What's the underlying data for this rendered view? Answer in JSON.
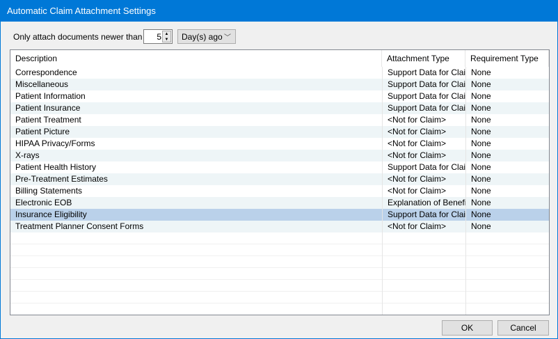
{
  "window": {
    "title": "Automatic Claim Attachment Settings"
  },
  "filter": {
    "label": "Only attach documents newer than :",
    "value": "5",
    "unit": "Day(s) ago"
  },
  "table": {
    "columns": [
      "Description",
      "Attachment Type",
      "Requirement Type"
    ],
    "rows": [
      [
        "Correspondence",
        "Support Data for Claim",
        "None"
      ],
      [
        "Miscellaneous",
        "Support Data for Claim",
        "None"
      ],
      [
        "Patient Information",
        "Support Data for Claim",
        "None"
      ],
      [
        "Patient Insurance",
        "Support Data for Claim",
        "None"
      ],
      [
        "Patient Treatment",
        "<Not for Claim>",
        "None"
      ],
      [
        "Patient Picture",
        "<Not for Claim>",
        "None"
      ],
      [
        "HIPAA Privacy/Forms",
        "<Not for Claim>",
        "None"
      ],
      [
        "X-rays",
        "<Not for Claim>",
        "None"
      ],
      [
        "Patient Health History",
        "Support Data for Claim",
        "None"
      ],
      [
        "Pre-Treatment Estimates",
        "<Not for Claim>",
        "None"
      ],
      [
        "Billing Statements",
        "<Not for Claim>",
        "None"
      ],
      [
        "Electronic EOB",
        "Explanation of Benefits",
        "None"
      ],
      [
        "Insurance Eligibility",
        "Support Data for Claim",
        "None"
      ],
      [
        "Treatment Planner Consent Forms",
        "<Not for Claim>",
        "None"
      ]
    ],
    "selected_index": 12
  },
  "buttons": {
    "ok": "OK",
    "cancel": "Cancel"
  }
}
